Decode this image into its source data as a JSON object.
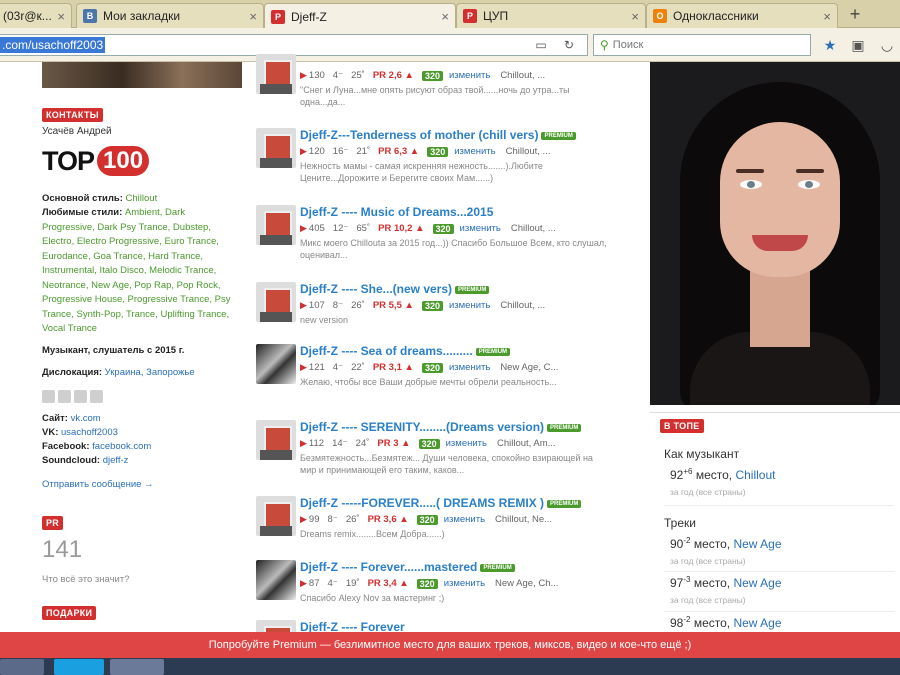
{
  "browser": {
    "tabs": [
      {
        "label": "(03r@к...",
        "favicon": "page-icon",
        "color": "#c9c3a4"
      },
      {
        "label": "Мои закладки",
        "favicon": "vk-icon",
        "color": "#4a76a8"
      },
      {
        "label": "Djeff-Z",
        "favicon": "pr-icon",
        "color": "#d32f2f"
      },
      {
        "label": "ЦУП",
        "favicon": "pr-icon",
        "color": "#d32f2f"
      },
      {
        "label": "Одноклассники",
        "favicon": "ok-icon",
        "color": "#ee8208"
      }
    ],
    "new_tab": "+",
    "url": ".com/usachoff2003",
    "search_placeholder": "Поиск"
  },
  "sidebar": {
    "contacts_badge": "КОНТАКТЫ",
    "owner_name": "Усачёв Андрей",
    "top_text": "TOP",
    "top_num": "100",
    "main_style_label": "Основной стиль:",
    "main_style_value": "Chillout",
    "fav_styles_label": "Любимые стили:",
    "fav_styles_value": "Ambient, Dark Progressive, Dark Psy Trance, Dubstep, Electro, Electro Progressive, Euro Trance, Eurodance, Goa Trance, Hard Trance, Instrumental, Italo Disco, Melodic Trance, Neotrance, New Age, Pop Rap, Pop Rock, Progressive House, Progressive Trance, Psy Trance, Synth-Pop, Trance, Uplifting Trance, Vocal Trance",
    "musician_since": "Музыкант, слушатель с 2015 г.",
    "location_label": "Дислокация:",
    "location_value": "Украина, Запорожье",
    "site_label": "Сайт:",
    "site_value": "vk.com",
    "vk_label": "VK:",
    "vk_value": "usachoff2003",
    "facebook_label": "Facebook:",
    "facebook_value": "facebook.com",
    "soundcloud_label": "Soundcloud:",
    "soundcloud_value": "djeff-z",
    "send_message": "Отправить сообщение →",
    "pr_badge": "PR",
    "pr_value": "141",
    "pr_question": "Что всё это значит?",
    "gifts_badge": "ПОДАРКИ"
  },
  "tracks": [
    {
      "title": "",
      "premium": false,
      "plays": "130",
      "comments": "4",
      "likes": "25",
      "pr": "PR 2,6 ▲",
      "quality": "320",
      "edit": "изменить",
      "style": "Chillout, ...",
      "desc": "\"Снег и Луна...мне опять рисуют образ твой......ночь до утра...ты одна...да...",
      "thumb": "red"
    },
    {
      "title": "Djeff-Z---Tenderness of mother (chill vers)",
      "premium": true,
      "plays": "120",
      "comments": "16",
      "likes": "21",
      "pr": "PR 6,3 ▲",
      "quality": "320",
      "edit": "изменить",
      "style": "Chillout, ...",
      "desc": "Нежность мамы - самая искренняя нежность.......).Любите Цените...Дорожите и Берегите своих Мам......)",
      "thumb": "red"
    },
    {
      "title": "Djeff-Z ---- Music of Dreams...2015",
      "premium": false,
      "plays": "405",
      "comments": "12",
      "likes": "65",
      "pr": "PR 10,2 ▲",
      "quality": "320",
      "edit": "изменить",
      "style": "Chillout, ...",
      "desc": "Микс моего Chillouta за 2015 год...)) Спасибо Большое Всем, кто слушал, оценивал...",
      "thumb": "red"
    },
    {
      "title": "Djeff-Z ---- She...(new vers)",
      "premium": true,
      "plays": "107",
      "comments": "8",
      "likes": "26",
      "pr": "PR 5,5 ▲",
      "quality": "320",
      "edit": "изменить",
      "style": "Chillout, ...",
      "desc": "new version",
      "thumb": "red"
    },
    {
      "title": "Djeff-Z ---- Sea of dreams.........",
      "premium": true,
      "plays": "121",
      "comments": "4",
      "likes": "22",
      "pr": "PR 3,1 ▲",
      "quality": "320",
      "edit": "изменить",
      "style": "New Age, C...",
      "desc": "Желаю, чтобы все Ваши добрые мечты обрели реальность...",
      "thumb": "bw"
    },
    {
      "title": "Djeff-Z ---- SERENITY........(Dreams version)",
      "premium": true,
      "plays": "112",
      "comments": "14",
      "likes": "24",
      "pr": "PR 3 ▲",
      "quality": "320",
      "edit": "изменить",
      "style": "Chillout, Am...",
      "desc": "Безмятежность...Безмятеж... Души человека, спокойно взирающей на мир и принимающей его таким, каков...",
      "thumb": "red"
    },
    {
      "title": "Djeff-Z -----FOREVER.....( DREAMS REMIX )",
      "premium": true,
      "plays": "99",
      "comments": "8",
      "likes": "26",
      "pr": "PR 3,6 ▲",
      "quality": "320",
      "edit": "изменить",
      "style": "Chillout, Ne...",
      "desc": "Dreams remix........Всем Добра......)",
      "thumb": "red"
    },
    {
      "title": "Djeff-Z ---- Forever......mastered",
      "premium": true,
      "plays": "87",
      "comments": "4",
      "likes": "19",
      "pr": "PR 3,4 ▲",
      "quality": "320",
      "edit": "изменить",
      "style": "New Age, Ch...",
      "desc": "Спасибо Alexy Nov за мастеринг ;)",
      "thumb": "bw"
    },
    {
      "title": "Djeff-Z ---- Forever",
      "premium": true,
      "plays": "",
      "comments": "",
      "likes": "",
      "pr": "",
      "quality": "",
      "edit": "",
      "style": "",
      "desc": "",
      "thumb": "red"
    }
  ],
  "ranking": {
    "badge": "В ТОПЕ",
    "musician_label": "Как музыкант",
    "musician_rank": "92",
    "musician_delta": "+6",
    "place_word": "место,",
    "musician_genre": "Chillout",
    "period": "за год (все страны)",
    "tracks_label": "Треки",
    "track_ranks": [
      {
        "rank": "90",
        "delta": "-2",
        "genre": "New Age"
      },
      {
        "rank": "97",
        "delta": "-3",
        "genre": "New Age"
      },
      {
        "rank": "98",
        "delta": "-2",
        "genre": "New Age"
      }
    ]
  },
  "promo": "Попробуйте Premium — безлимитное место для ваших треков, миксов, видео и кое-что ещё ;)",
  "colors": {
    "accent_red": "#d32f2f",
    "link_blue": "#2a7fc8",
    "green": "#4a9a2c",
    "promo_red": "#e04545"
  }
}
